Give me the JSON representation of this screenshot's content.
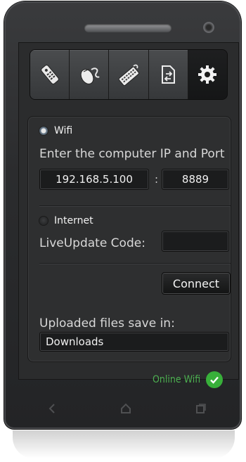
{
  "toolbar": {
    "items": [
      {
        "icon": "remote-icon",
        "active": false
      },
      {
        "icon": "mouse-icon",
        "active": false
      },
      {
        "icon": "keyboard-icon",
        "active": false
      },
      {
        "icon": "file-transfer-icon",
        "active": false
      },
      {
        "icon": "gear-icon",
        "active": true
      }
    ]
  },
  "wifi": {
    "label": "Wifi",
    "selected": true,
    "prompt": "Enter the computer IP and Port",
    "ip_value": "192.168.5.100",
    "separator": ":",
    "port_value": "8889"
  },
  "internet": {
    "label": "Internet",
    "selected": false,
    "code_label": "LiveUpdate Code:",
    "code_value": ""
  },
  "connect": {
    "label": "Connect"
  },
  "uploads": {
    "label": "Uploaded files save in:",
    "folder_value": "Downloads"
  },
  "status": {
    "text": "Online Wifi",
    "icon": "check-circle-icon",
    "color": "#4caf50"
  },
  "nav": {
    "back_icon": "back-icon",
    "home_icon": "home-icon",
    "recents_icon": "recents-icon"
  }
}
